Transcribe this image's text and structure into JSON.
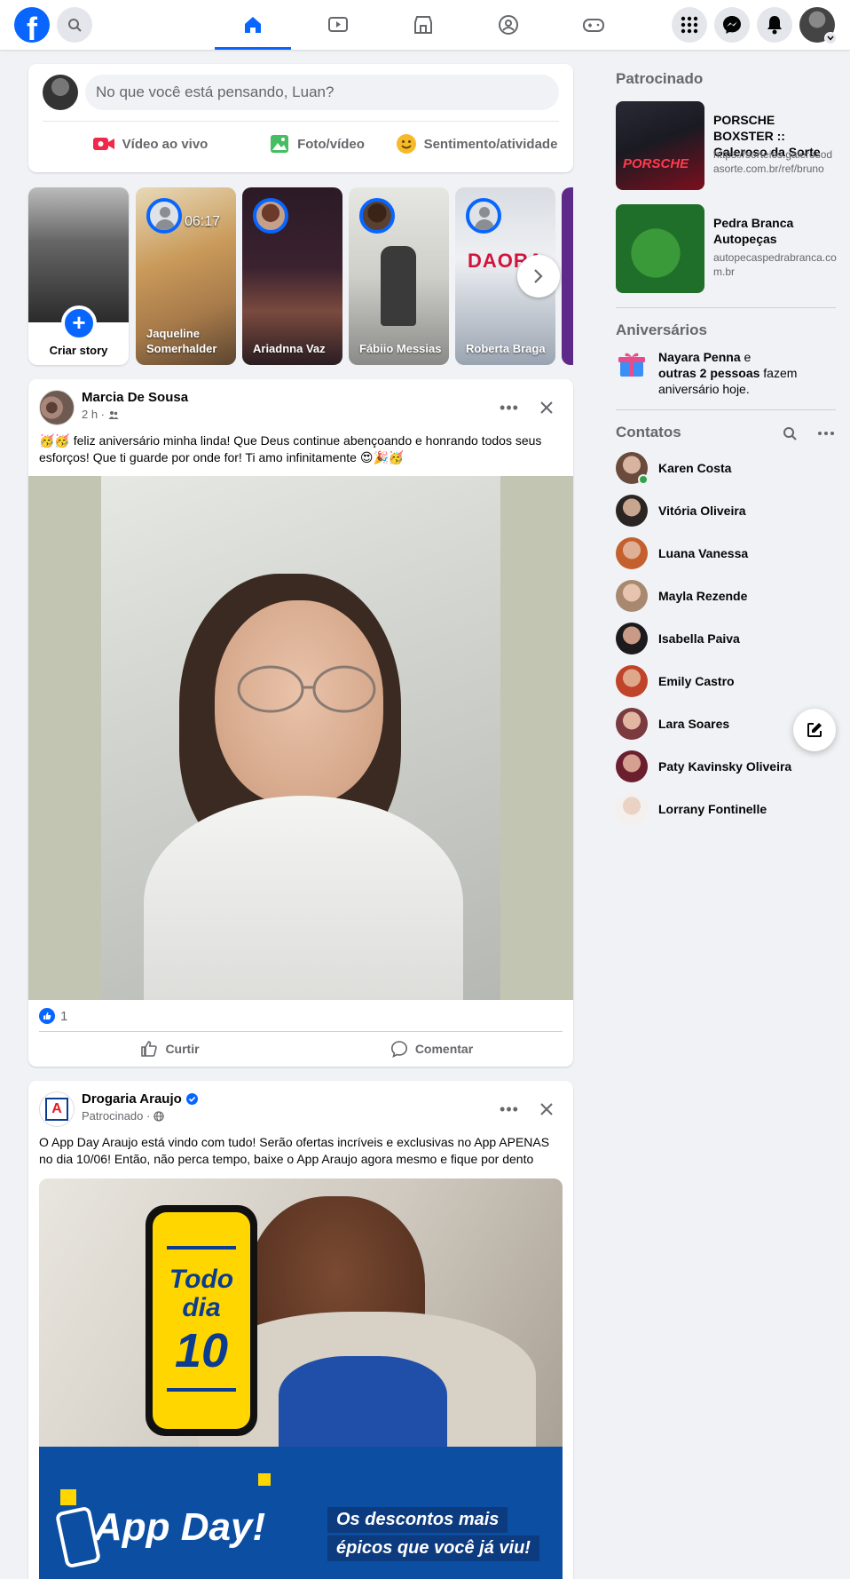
{
  "topbar": {
    "logo_letter": "f",
    "nav_tabs": [
      "home-icon",
      "video-icon",
      "marketplace-icon",
      "groups-icon",
      "gaming-icon"
    ],
    "right_icons": [
      "menu-grid-icon",
      "messenger-icon",
      "notifications-icon",
      "account-avatar"
    ]
  },
  "composer": {
    "placeholder": "No que você está pensando, Luan?",
    "live_label": "Vídeo ao vivo",
    "photo_label": "Foto/vídeo",
    "feeling_label": "Sentimento/atividade"
  },
  "stories": {
    "create_label": "Criar story",
    "items": [
      {
        "name": "Jaqueline Somerhalder",
        "overlay": "06:17"
      },
      {
        "name": "Ariadnna Vaz"
      },
      {
        "name": "Fábiio Messias"
      },
      {
        "name": "Roberta Braga",
        "overlay": "DAORA"
      }
    ]
  },
  "post1": {
    "author": "Marcia De Sousa",
    "time": "2 h ·",
    "text": "🥳🥳 feliz aniversário minha linda! Que Deus continue abençoando e honrando todos seus esforços! Que ti guarde por onde for! Ti amo infinitamente 😍🎉🥳",
    "reaction_count": "1",
    "like_label": "Curtir",
    "comment_label": "Comentar",
    "more": "•••"
  },
  "post2": {
    "author": "Drogaria Araujo",
    "meta": "Patrocinado ·",
    "text": "O App Day Araujo está vindo com tudo! Serão ofertas incríveis e exclusivas no App APENAS no dia 10/06! Então, não perca tempo, baixe o App Araujo agora mesmo e fique por dento",
    "phone_line1": "Todo",
    "phone_line2": "dia",
    "phone_line3": "10",
    "banner_title": "App Day!",
    "banner_tag1": "Os descontos mais",
    "banner_tag2": "épicos que você já viu!",
    "avatar_letter": "A",
    "more": "•••"
  },
  "sidebar": {
    "sponsored_title": "Patrocinado",
    "ads": [
      {
        "title": "PORSCHE BOXSTER :: Galeroso da Sorte",
        "url": "https://sorteios.galerosodasorte.com.br/ref/bruno",
        "thumb_text": "PORSCHE"
      },
      {
        "title": "Pedra Branca Autopeças",
        "url": "autopecaspedrabranca.com.br"
      }
    ],
    "birthdays_title": "Aniversários",
    "birthday_name": "Nayara Penna",
    "birthday_rest1": " e",
    "birthday_bold2": "outras 2 pessoas",
    "birthday_rest2": " fazem aniversário hoje.",
    "contacts_title": "Contatos",
    "contacts": [
      {
        "name": "Karen Costa",
        "online": true
      },
      {
        "name": "Vitória Oliveira"
      },
      {
        "name": "Luana Vanessa"
      },
      {
        "name": "Mayla Rezende"
      },
      {
        "name": "Isabella Paiva"
      },
      {
        "name": "Emily Castro"
      },
      {
        "name": "Lara Soares"
      },
      {
        "name": "Paty Kavinsky Oliveira"
      },
      {
        "name": "Lorrany Fontinelle"
      }
    ]
  },
  "colors": {
    "brand": "#0866ff",
    "background": "#f0f2f5",
    "secondary_text": "#65676b",
    "online": "#31a24c"
  }
}
